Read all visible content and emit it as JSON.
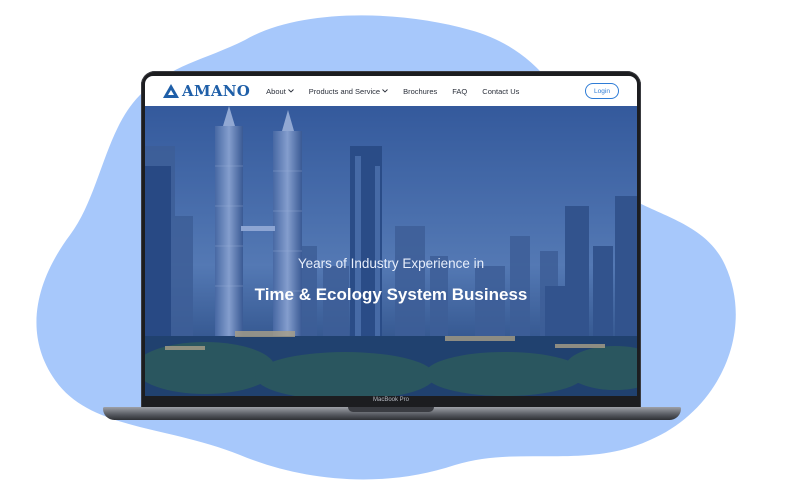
{
  "colors": {
    "blob": "#a7c8fb",
    "brand": "#1f5fa8",
    "accent": "#2e7cd6",
    "laptop_frame": "#1c1d20"
  },
  "site": {
    "logo_text": "AMANO",
    "logo_icon": "amano-triangle-icon"
  },
  "nav": {
    "items": [
      {
        "label": "About",
        "has_dropdown": true
      },
      {
        "label": "Products and Service",
        "has_dropdown": true
      },
      {
        "label": "Brochures",
        "has_dropdown": false
      },
      {
        "label": "FAQ",
        "has_dropdown": false
      },
      {
        "label": "Contact Us",
        "has_dropdown": false
      }
    ],
    "login_label": "Login"
  },
  "hero": {
    "subtitle": "Years of Industry Experience in",
    "title": "Time & Ecology System Business"
  },
  "device": {
    "label": "MacBook Pro"
  }
}
